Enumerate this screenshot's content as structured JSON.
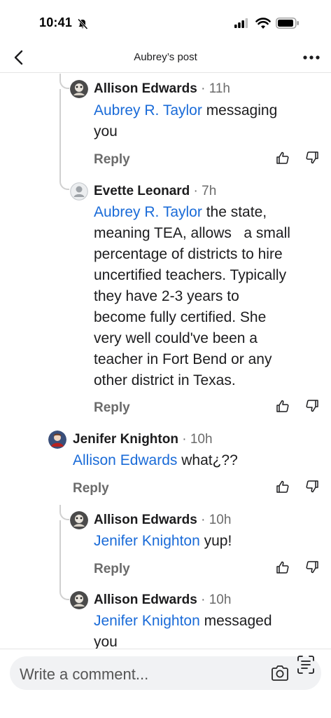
{
  "status_bar": {
    "time": "10:41"
  },
  "nav": {
    "title": "Aubrey’s post"
  },
  "comments": [
    {
      "author": "Allison Edwards",
      "meta": " · 11h",
      "mention": "Aubrey R. Taylor",
      "lines": [
        " messaging",
        "you"
      ],
      "reply": "Reply"
    },
    {
      "author": "Evette Leonard",
      "meta": " · 7h",
      "mention": "Aubrey R. Taylor",
      "lines": [
        " the state,",
        "meaning TEA, allows   a small",
        "percentage of districts to hire",
        "uncertified teachers. Typically",
        "they have 2-3 years to",
        "become fully certified. She",
        "very well could've been a",
        "teacher in Fort Bend or any",
        "other district in Texas."
      ],
      "reply": "Reply"
    },
    {
      "author": "Jenifer Knighton",
      "meta": " · 10h",
      "mention": "Allison Edwards",
      "lines": [
        " what¿??"
      ],
      "reply": "Reply"
    },
    {
      "author": "Allison Edwards",
      "meta": " · 10h",
      "mention": "Jenifer Knighton",
      "lines": [
        " yup!"
      ],
      "reply": "Reply"
    },
    {
      "author": "Allison Edwards",
      "meta": " · 10h",
      "mention": "Jenifer Knighton",
      "lines": [
        " messaged",
        "you"
      ],
      "reply": ""
    }
  ],
  "composer": {
    "placeholder": "Write a comment..."
  },
  "colors": {
    "mention": "#1a6bd8",
    "meta": "#6b6b6b",
    "thread": "#d0d0d0"
  }
}
